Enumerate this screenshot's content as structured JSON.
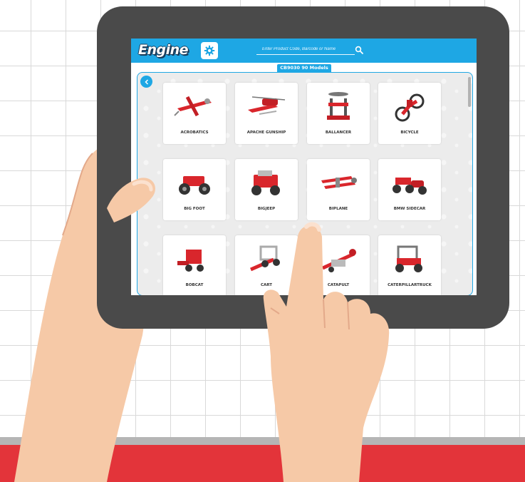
{
  "app": {
    "logo": "Engine",
    "search_placeholder": "Enter Product Code, Barcode or Name",
    "collection_title": "CB9030 90 Models"
  },
  "icons": {
    "settings": "gear-icon",
    "search": "search-icon",
    "back": "chevron-left-icon"
  },
  "colors": {
    "accent": "#1ea7e4",
    "brand_red": "#e3343a",
    "tablet_frame": "#4a4a4a"
  },
  "models": [
    {
      "label": "ACROBATICS"
    },
    {
      "label": "APACHE GUNSHIP"
    },
    {
      "label": "BALLANCER"
    },
    {
      "label": "BICYCLE"
    },
    {
      "label": "BIG FOOT"
    },
    {
      "label": "BIGJEEP"
    },
    {
      "label": "BIPLANE"
    },
    {
      "label": "BMW SIDECAR"
    },
    {
      "label": "BOBCAT"
    },
    {
      "label": "CART"
    },
    {
      "label": "CATAPULT"
    },
    {
      "label": "CATERPILLARTRUCK"
    }
  ]
}
